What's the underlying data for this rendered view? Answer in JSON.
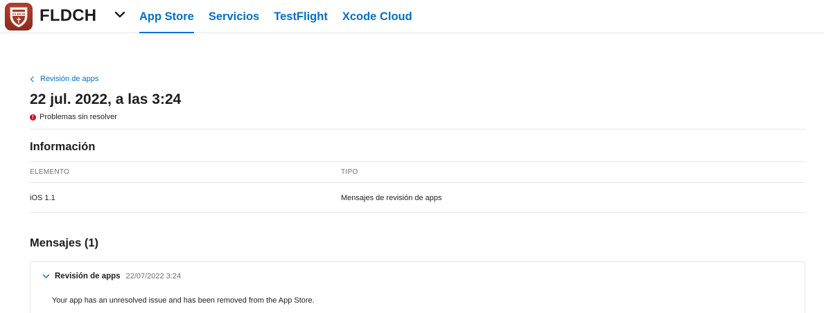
{
  "app": {
    "name": "FLDCH",
    "icon": "shield-logo-icon",
    "icon_text": "FLDCH",
    "brand_color": "#a13826"
  },
  "nav": {
    "tabs": [
      {
        "label": "App Store",
        "active": true
      },
      {
        "label": "Servicios",
        "active": false
      },
      {
        "label": "TestFlight",
        "active": false
      },
      {
        "label": "Xcode Cloud",
        "active": false
      }
    ],
    "accent_color": "#0070c9"
  },
  "breadcrumb": {
    "label": "Revisión de apps"
  },
  "page": {
    "title": "22 jul. 2022, a las 3:24",
    "status": "Problemas sin resolver",
    "status_color": "#d70015"
  },
  "info": {
    "title": "Información",
    "columns": [
      "ELEMENTO",
      "TIPO"
    ],
    "rows": [
      [
        "iOS 1.1",
        "Mensajes de revisión de apps"
      ]
    ]
  },
  "messages": {
    "title": "Mensajes (1)",
    "items": [
      {
        "title": "Revisión de apps",
        "date": "22/07/2022 3:24",
        "body": "Your app has an unresolved issue and has been removed from the App Store.",
        "expanded": true
      }
    ]
  }
}
